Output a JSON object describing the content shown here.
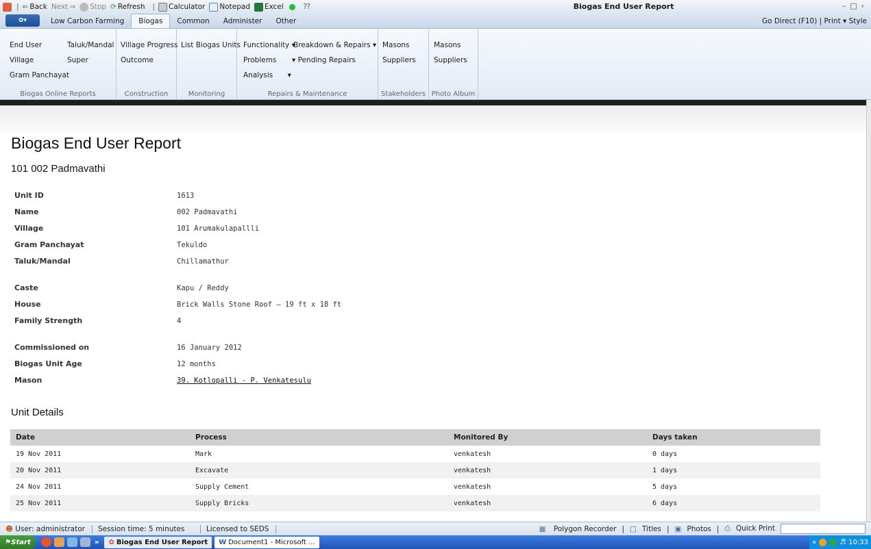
{
  "titlebar": {
    "back": "Back",
    "next": "Next",
    "stop": "Stop",
    "refresh": "Refresh",
    "calculator": "Calculator",
    "notepad": "Notepad",
    "excel": "Excel",
    "window_title": "Biogas End User Report"
  },
  "tabs": {
    "items": [
      "Low Carbon Farming",
      "Biogas",
      "Common",
      "Administer",
      "Other"
    ],
    "active": "Biogas",
    "right": "Go Direct (F10) | Print ▾ Style"
  },
  "ribbon": {
    "online_reports": {
      "label": "Biogas Online Reports",
      "items": [
        "End User",
        "Taluk/Mandal",
        "Village",
        "Super",
        "Gram Panchayat"
      ]
    },
    "construction": {
      "label": "Construction",
      "items": [
        "Village Progress",
        "Outcome"
      ]
    },
    "monitoring": {
      "label": "Monitoring",
      "items": [
        "List Biogas Units"
      ]
    },
    "repairs": {
      "label": "Repairs & Maintenance",
      "items": [
        "Functionality",
        "Breakdown & Repairs",
        "Problems",
        "Pending Repairs",
        "Analysis"
      ]
    },
    "stakeholders": {
      "label": "Stakeholders",
      "items": [
        "Masons",
        "Suppliers"
      ]
    },
    "photo_album": {
      "label": "Photo Album",
      "items": [
        "Masons",
        "Suppliers"
      ]
    }
  },
  "report": {
    "title": "Biogas End User Report",
    "subtitle": "101 002 Padmavathi",
    "fields": [
      {
        "label": "Unit ID",
        "value": "1613"
      },
      {
        "label": "Name",
        "value": "002 Padmavathi"
      },
      {
        "label": "Village",
        "value": "101 Arumakulapallli"
      },
      {
        "label": "Gram Panchayat",
        "value": "Tekuldo"
      },
      {
        "label": "Taluk/Mandal",
        "value": "Chillamathur"
      },
      {
        "label": "Caste",
        "value": "Kapu / Reddy"
      },
      {
        "label": "House",
        "value": "Brick Walls Stone Roof — 19 ft x 18 ft"
      },
      {
        "label": "Family Strength",
        "value": "4"
      },
      {
        "label": "Commissioned on",
        "value": "16 January 2012"
      },
      {
        "label": "Biogas Unit Age",
        "value": "12 months"
      },
      {
        "label": "Mason",
        "value": "39. Kotlopalli - P. Venkatesulu"
      }
    ],
    "unit_details_heading": "Unit Details",
    "table": {
      "columns": [
        "Date",
        "Process",
        "Monitored By",
        "Days taken"
      ],
      "rows": [
        [
          "19 Nov 2011",
          "Mark",
          "venkatesh",
          "0 days"
        ],
        [
          "20 Nov 2011",
          "Excavate",
          "venkatesh",
          "1 days"
        ],
        [
          "24 Nov 2011",
          "Supply Cement",
          "venkatesh",
          "5 days"
        ],
        [
          "25 Nov 2011",
          "Supply Bricks",
          "venkatesh",
          "6 days"
        ]
      ]
    }
  },
  "statusbar": {
    "user": "User: administrator",
    "session": "Session time: 5 minutes",
    "license": "Licensed to SEDS",
    "polygon": "Polygon Recorder",
    "titles": "Titles",
    "photos": "Photos",
    "quickprint": "Quick Print"
  },
  "taskbar": {
    "start": "Start",
    "app_active": "Biogas End User Report",
    "app_other": "Document1 - Microsoft ...",
    "clock": "10:33"
  }
}
